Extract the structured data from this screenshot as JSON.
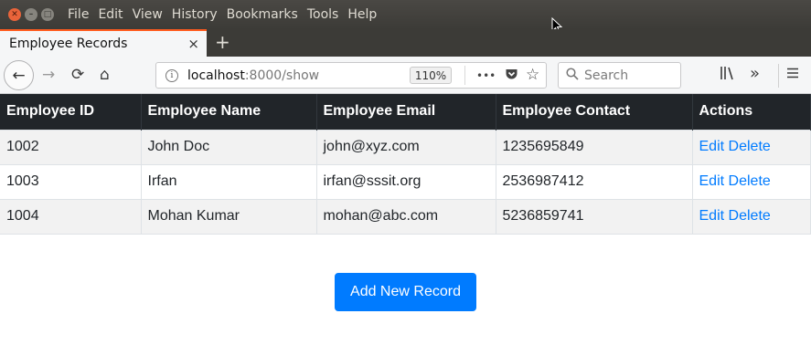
{
  "window": {
    "menu": [
      "File",
      "Edit",
      "View",
      "History",
      "Bookmarks",
      "Tools",
      "Help"
    ]
  },
  "tab": {
    "title": "Employee Records",
    "close": "×",
    "new_tab": "+"
  },
  "nav": {
    "back": "←",
    "forward": "→",
    "reload": "⟳",
    "home": "⌂",
    "url_host": "localhost",
    "url_rest": ":8000/show",
    "zoom": "110%",
    "page_actions": "•••",
    "search_placeholder": "Search"
  },
  "table": {
    "headers": [
      "Employee ID",
      "Employee Name",
      "Employee Email",
      "Employee Contact",
      "Actions"
    ],
    "rows": [
      {
        "id": "1002",
        "name": "John Doc",
        "email": "john@xyz.com",
        "contact": "1235695849",
        "edit": "Edit",
        "delete": "Delete"
      },
      {
        "id": "1003",
        "name": "Irfan",
        "email": "irfan@sssit.org",
        "contact": "2536987412",
        "edit": "Edit",
        "delete": "Delete"
      },
      {
        "id": "1004",
        "name": "Mohan Kumar",
        "email": "mohan@abc.com",
        "contact": "5236859741",
        "edit": "Edit",
        "delete": "Delete"
      }
    ]
  },
  "add_button": "Add New Record",
  "colors": {
    "table_header_bg": "#212529",
    "link": "#007bff",
    "button_bg": "#007bff",
    "tab_accent": "#ff5c1f",
    "titlebar_bg": "#3c3b37"
  },
  "icons": {
    "window": [
      "close-icon",
      "minimize-icon",
      "maximize-icon"
    ],
    "nav": [
      "back-arrow-icon",
      "forward-arrow-icon",
      "reload-icon",
      "home-icon",
      "info-icon",
      "pocket-icon",
      "star-icon",
      "search-icon",
      "library-icon",
      "overflow-chevron-icon",
      "hamburger-menu-icon"
    ]
  }
}
